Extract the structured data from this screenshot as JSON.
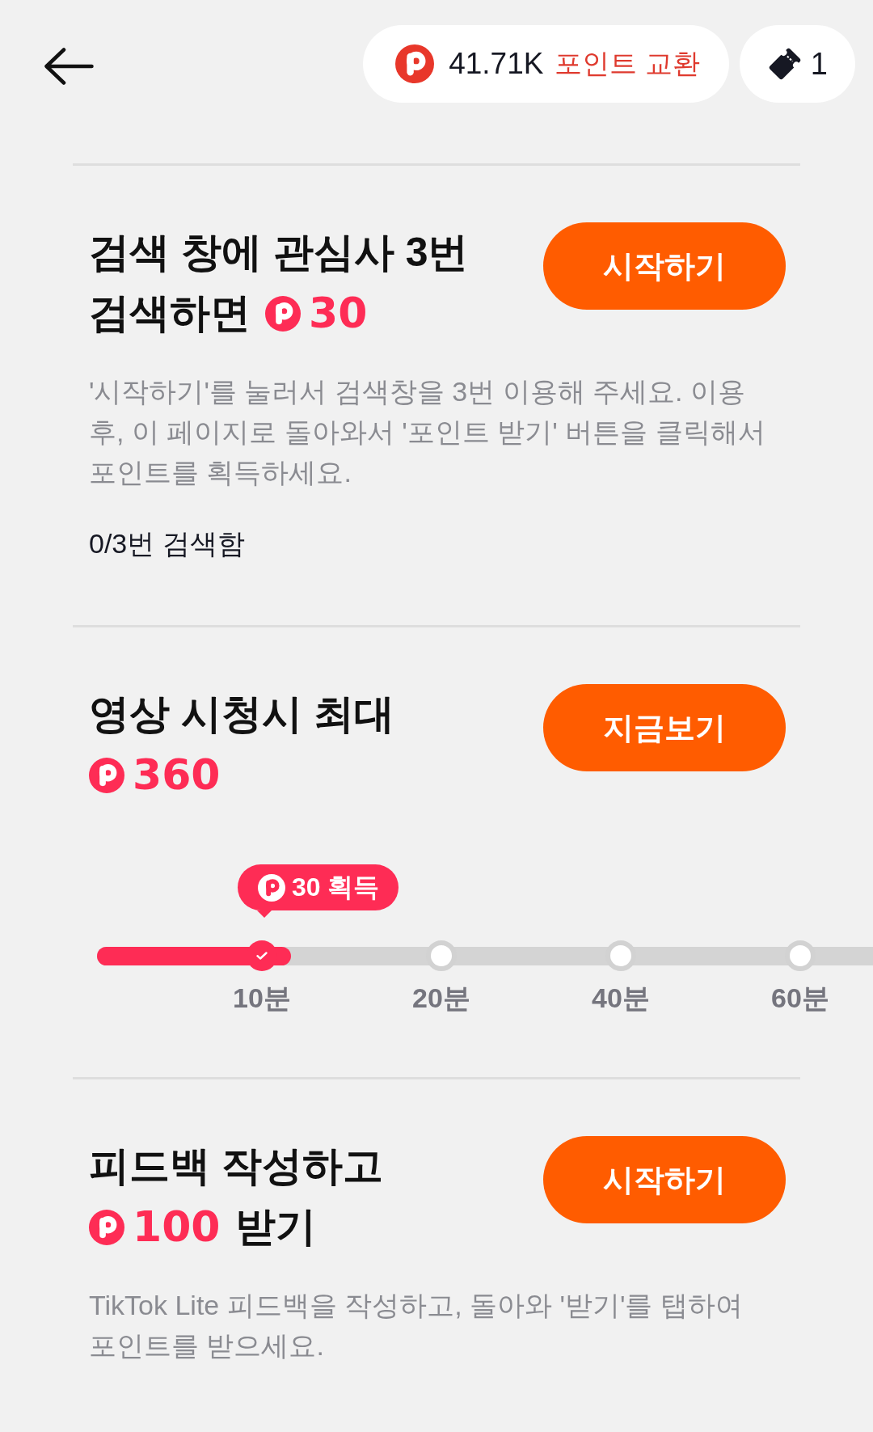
{
  "header": {
    "points_balance": "41.71K",
    "exchange_label": "포인트 교환",
    "ticket_count": "1"
  },
  "tasks": [
    {
      "title": "검색 창에 관심사 3번 검색하면",
      "reward": "30",
      "button": "시작하기",
      "description": "'시작하기'를 눌러서 검색창을 3번 이용해 주세요. 이용 후, 이 페이지로 돌아와서 '포인트 받기' 버튼을 클릭해서 포인트를 획득하세요.",
      "progress_text": "0/3번 검색함"
    },
    {
      "title": "영상 시청시 최대",
      "reward": "360",
      "button": "지금보기",
      "progress": {
        "level": 0.25,
        "milestones": [
          {
            "label": "10분",
            "reached": true,
            "tooltip": "30 획득"
          },
          {
            "label": "20분",
            "reached": false
          },
          {
            "label": "40분",
            "reached": false
          },
          {
            "label": "60분",
            "reached": false
          }
        ]
      }
    },
    {
      "title": "피드백 작성하고",
      "reward": "100",
      "title_after": "받기",
      "button": "시작하기",
      "description": "TikTok Lite 피드백을 작성하고, 돌아와 '받기'를 탭하여 포인트를 받으세요."
    }
  ]
}
